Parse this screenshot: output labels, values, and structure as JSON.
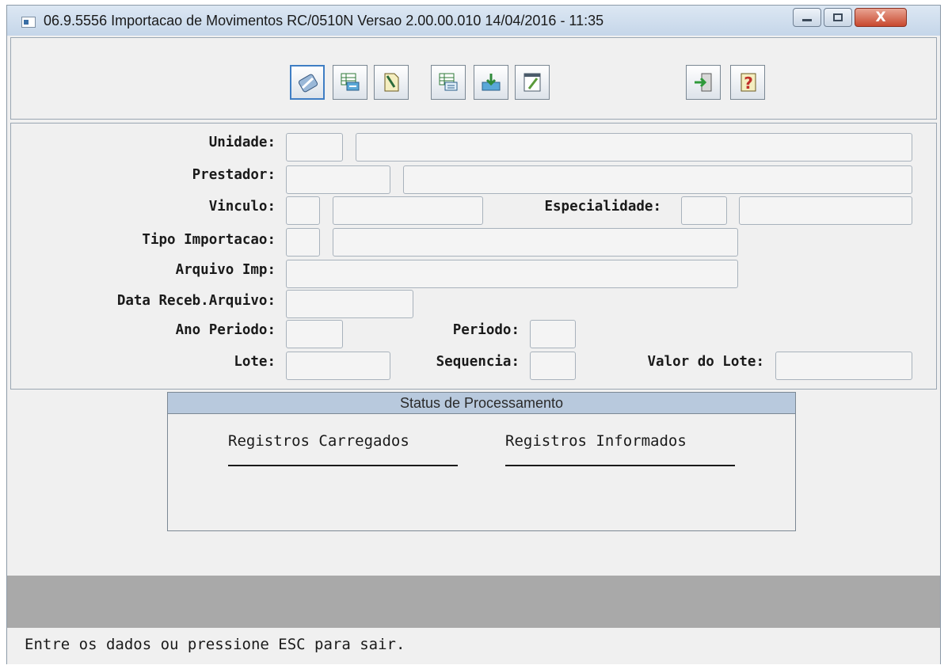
{
  "window": {
    "title": "06.9.5556 Importacao de  Movimentos RC/0510N Versao 2.00.00.010 14/04/2016 - 11:35",
    "close_label": "X"
  },
  "toolbar": {
    "buttons": [
      {
        "icon": "edit-eraser-icon"
      },
      {
        "icon": "import-table-icon"
      },
      {
        "icon": "edit-document-icon"
      },
      {
        "icon": "table-list-icon"
      },
      {
        "icon": "upload-document-icon"
      },
      {
        "icon": "pencil-document-icon"
      },
      {
        "icon": "exit-door-icon"
      },
      {
        "icon": "help-question-icon"
      }
    ]
  },
  "form": {
    "unidade_label": "Unidade:",
    "prestador_label": "Prestador:",
    "vinculo_label": "Vinculo:",
    "especialidade_label": "Especialidade:",
    "tipo_importacao_label": "Tipo Importacao:",
    "arquivo_imp_label": "Arquivo Imp:",
    "data_receb_label": "Data Receb.Arquivo:",
    "ano_periodo_label": "Ano Periodo:",
    "periodo_label": "Periodo:",
    "lote_label": "Lote:",
    "sequencia_label": "Sequencia:",
    "valor_lote_label": "Valor do Lote:"
  },
  "status_panel": {
    "title": "Status de Processamento",
    "col1": "Registros Carregados",
    "col2": "Registros Informados"
  },
  "status_line": {
    "text": "Entre os dados ou pressione ESC para sair."
  },
  "colors": {
    "window_bg": "#f0f0f0",
    "status_header": "#b8c9dd",
    "message_area": "#a9a9a9"
  }
}
